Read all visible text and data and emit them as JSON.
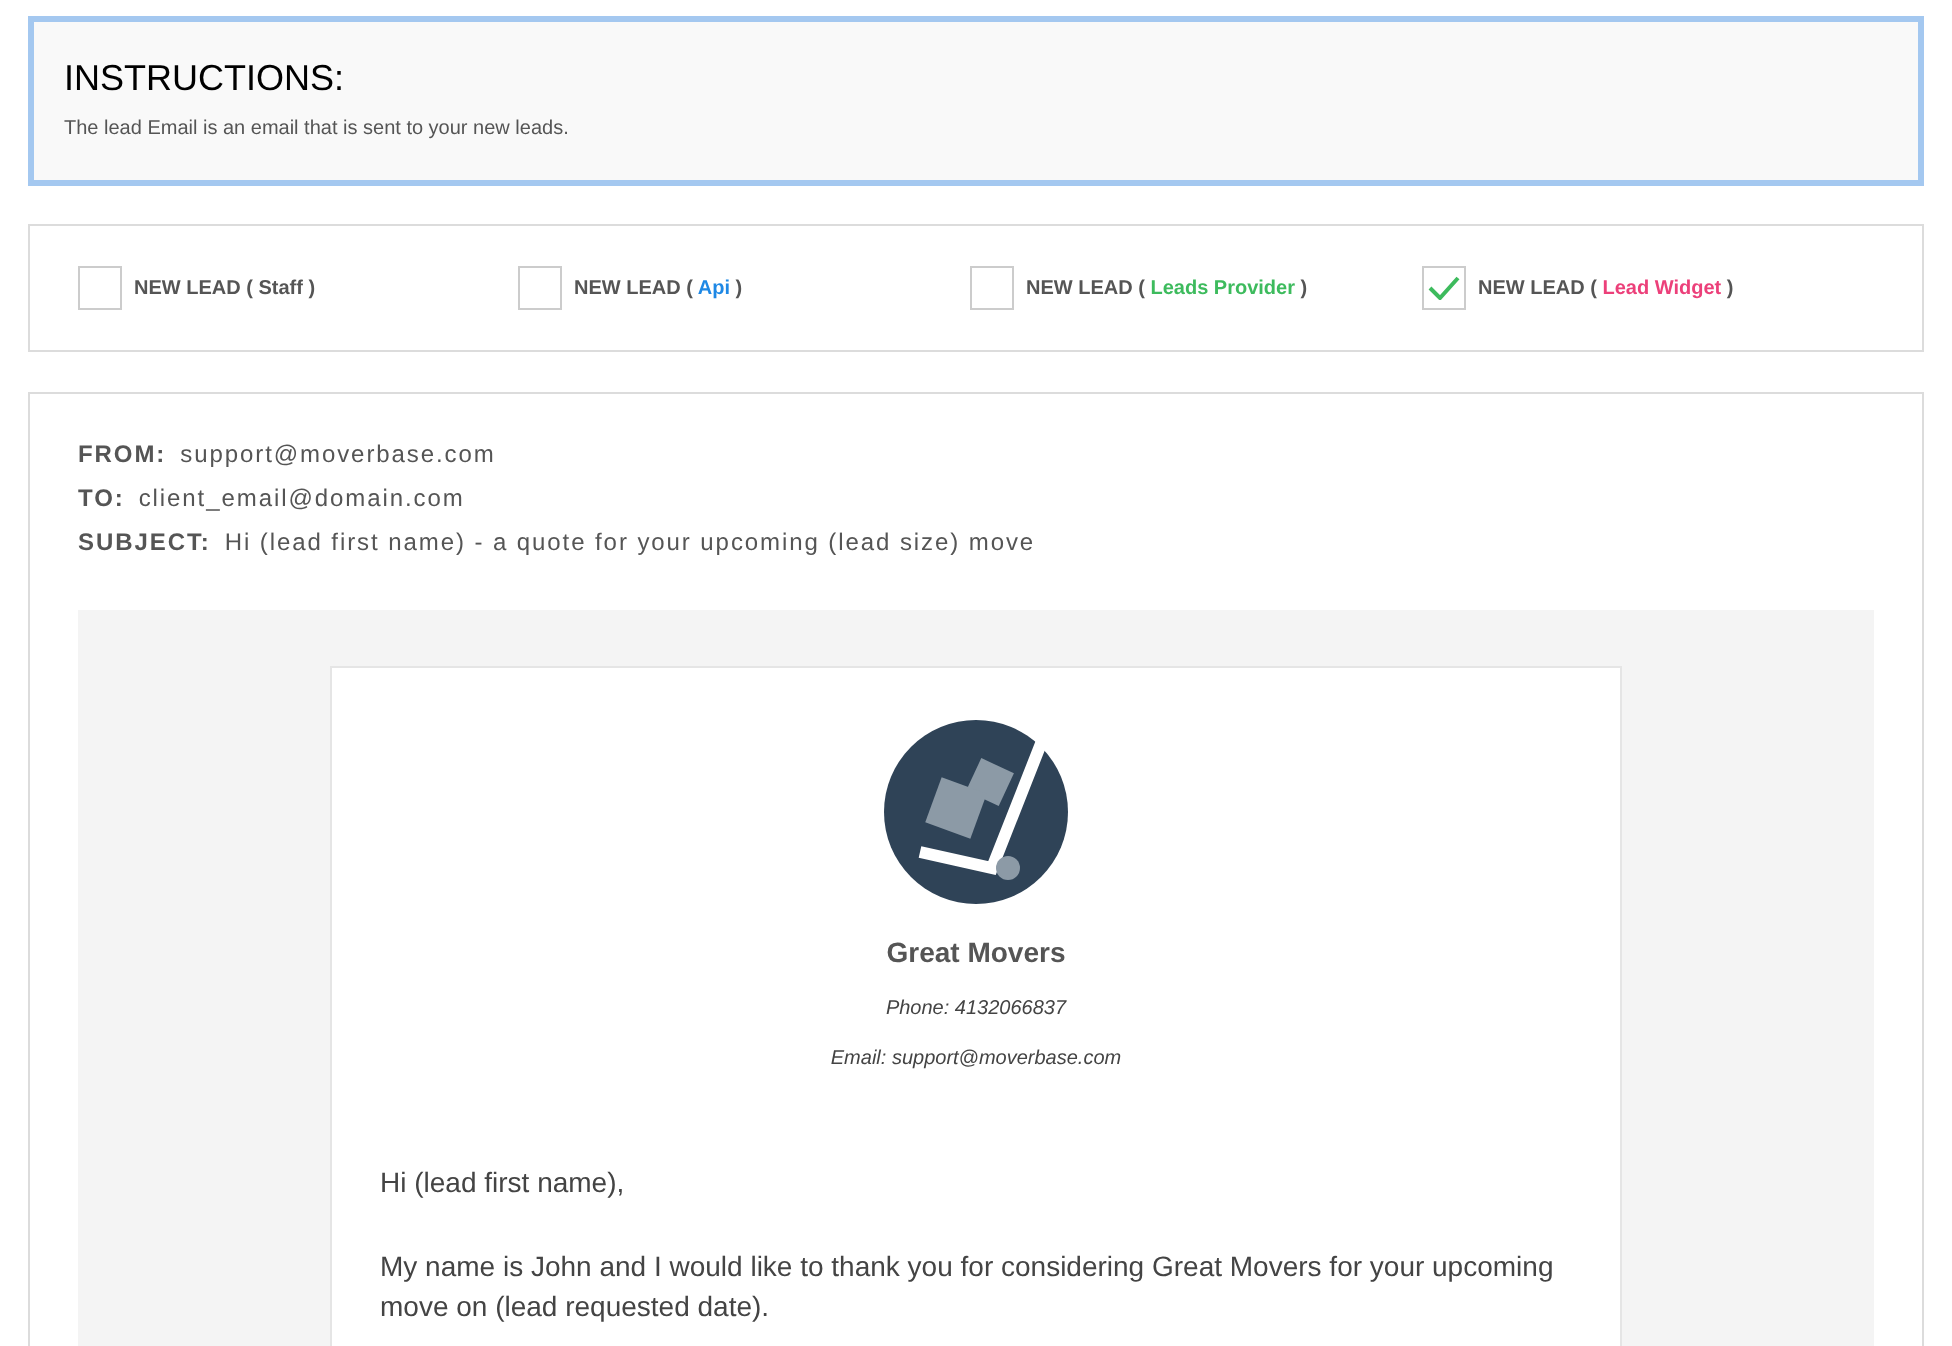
{
  "instructions": {
    "title": "INSTRUCTIONS:",
    "text": "The lead Email is an email that is sent to your new leads."
  },
  "lead_types": [
    {
      "label": "NEW LEAD (",
      "tag": "Staff",
      "suffix": ")",
      "color": "#555555",
      "checked": false
    },
    {
      "label": "NEW LEAD (",
      "tag": "Api",
      "suffix": ")",
      "color": "#1e88e5",
      "checked": false
    },
    {
      "label": "NEW LEAD (",
      "tag": "Leads Provider",
      "suffix": ")",
      "color": "#3dbb5d",
      "checked": false
    },
    {
      "label": "NEW LEAD (",
      "tag": "Lead Widget",
      "suffix": ")",
      "color": "#ec407a",
      "checked": true
    }
  ],
  "email_headers": [
    {
      "label": "FROM:",
      "value": "support@moverbase.com"
    },
    {
      "label": "TO:",
      "value": "client_email@domain.com"
    },
    {
      "label": "SUBJECT:",
      "value": "Hi (lead first name) - a quote for your upcoming (lead size) move"
    }
  ],
  "email": {
    "company": "Great Movers",
    "phone": "Phone: 4132066837",
    "contact_email": "Email: support@moverbase.com",
    "paragraphs": [
      "Hi (lead first name),",
      "My name is John and I would like to thank you for considering Great Movers for your upcoming move on (lead requested date)."
    ]
  }
}
